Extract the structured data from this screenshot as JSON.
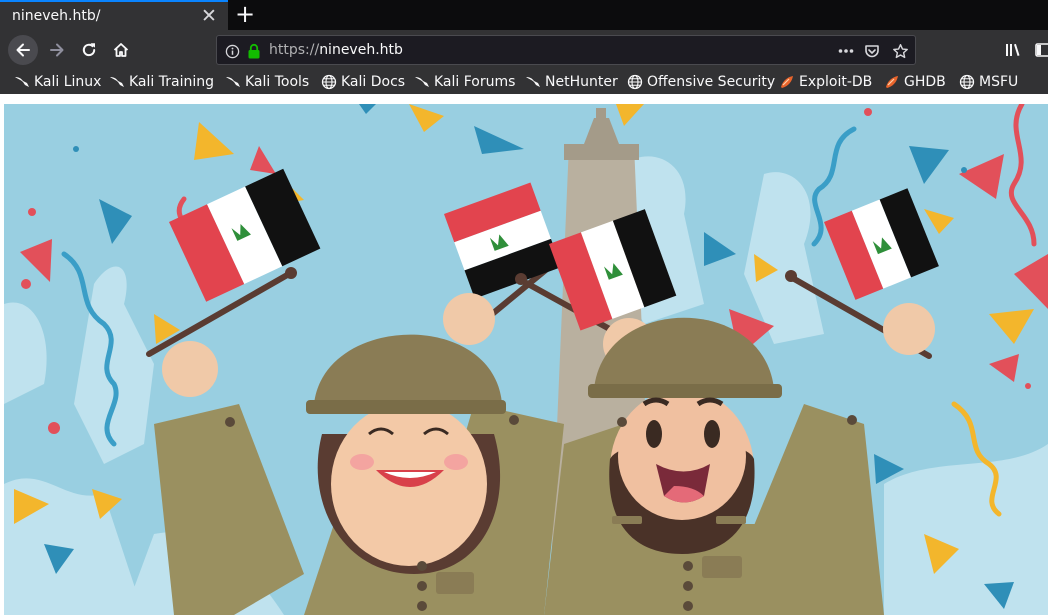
{
  "tab": {
    "title": "nineveh.htb/"
  },
  "navbar": {
    "url_scheme": "https://",
    "url_host": "nineveh.htb"
  },
  "bookmarks": [
    {
      "label": "Kali Linux",
      "icon": "kali-dragon-icon"
    },
    {
      "label": "Kali Training",
      "icon": "kali-dragon-icon"
    },
    {
      "label": "Kali Tools",
      "icon": "kali-dragon-icon"
    },
    {
      "label": "Kali Docs",
      "icon": "globe-icon"
    },
    {
      "label": "Kali Forums",
      "icon": "kali-dragon-icon"
    },
    {
      "label": "NetHunter",
      "icon": "kali-dragon-icon"
    },
    {
      "label": "Offensive Security",
      "icon": "globe-icon"
    },
    {
      "label": "Exploit-DB",
      "icon": "exploit-db-icon"
    },
    {
      "label": "GHDB",
      "icon": "exploit-db-icon"
    },
    {
      "label": "MSFU",
      "icon": "globe-icon"
    }
  ],
  "colors": {
    "accent": "#0a84ff",
    "toolbar": "#323234",
    "lock": "#12bc00",
    "sky": "#99cfe1",
    "helmet": "#8a7c55",
    "uniform": "#9a9060"
  }
}
